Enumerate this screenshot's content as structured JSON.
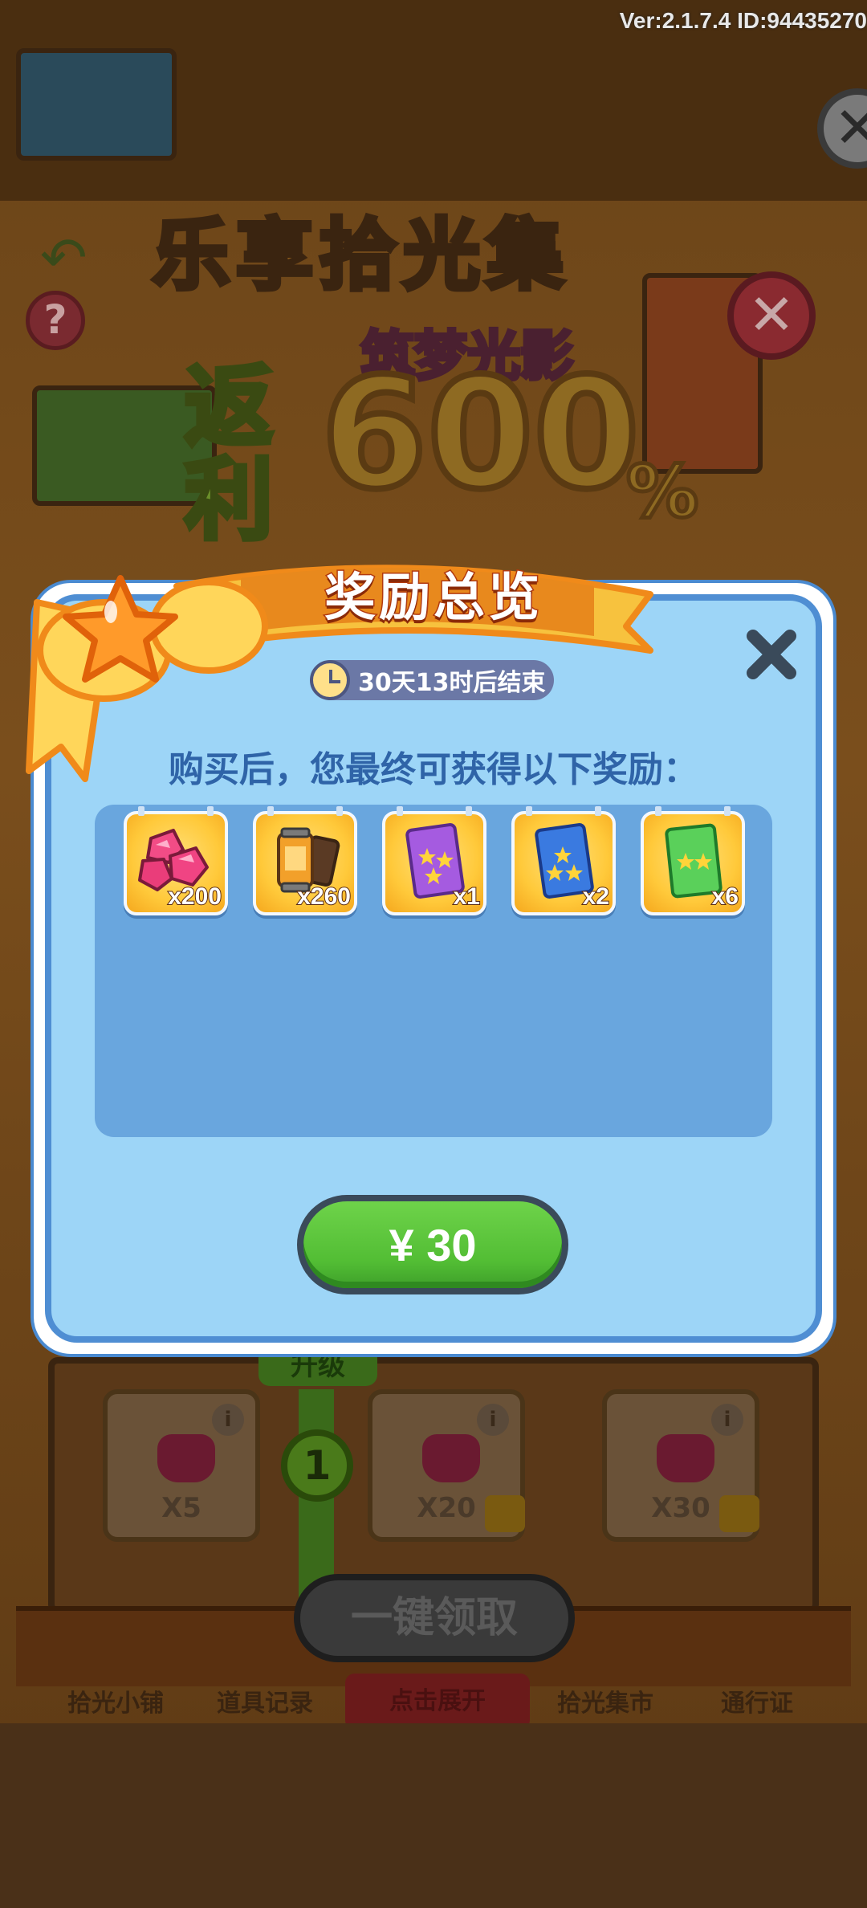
{
  "version_info": "Ver:2.1.7.4 ID:94435270",
  "background": {
    "event_title": "乐享拾光集",
    "promo_side": "返利",
    "promo_value": "600",
    "promo_percent": "%",
    "promo_subtitle": "筑梦光影",
    "upgrade_label": "升级",
    "level_number": "1",
    "slots": [
      {
        "count": "X5",
        "locked": false,
        "claimed": true
      },
      {
        "count": "X20",
        "locked": true,
        "claimed": false
      },
      {
        "count": "X30",
        "locked": true,
        "claimed": false
      }
    ],
    "claim_all_label": "一键领取",
    "nav": {
      "shop": "拾光小铺",
      "records": "道具记录",
      "expand": "点击展开",
      "market": "拾光集市",
      "pass": "通行证"
    }
  },
  "modal": {
    "title": "奖励总览",
    "timer": "30天13时后结束",
    "subtitle": "购买后，您最终可获得以下奖励：",
    "rewards": [
      {
        "icon": "pink-gem-icon",
        "quantity": "x200"
      },
      {
        "icon": "film-roll-icon",
        "quantity": "x260"
      },
      {
        "icon": "purple-star-pack-icon",
        "quantity": "x1"
      },
      {
        "icon": "blue-star-pack-icon",
        "quantity": "x2"
      },
      {
        "icon": "green-star-pack-icon",
        "quantity": "x6"
      }
    ],
    "price_label": "¥ 30"
  },
  "colors": {
    "modal_bg": "#9dd5f7",
    "modal_border": "#4f8ed3",
    "reward_bg": "#ffc93a",
    "buy_button": "#52bd34",
    "title_stroke": "#b23a0f"
  }
}
